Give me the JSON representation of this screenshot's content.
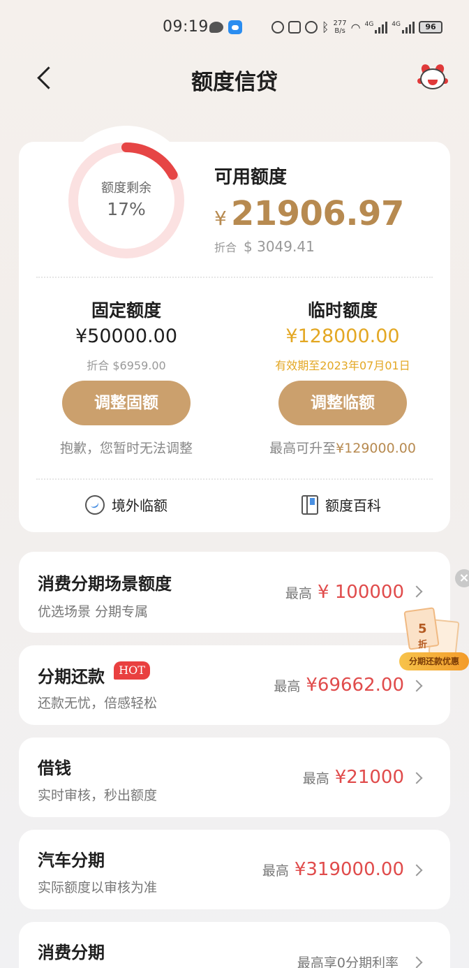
{
  "status": {
    "time": "09:19",
    "net_rate_top": "277",
    "net_rate_bottom": "B/s",
    "net1": "4G",
    "net2": "4G",
    "battery": "96"
  },
  "header": {
    "title": "额度信贷"
  },
  "summary": {
    "ring_label": "额度剩余",
    "ring_percent_text": "17%",
    "ring_fraction": 0.17,
    "available_label": "可用额度",
    "currency": "¥",
    "available_amount": "21906.97",
    "usd_label": "折合",
    "usd_value": "$ 3049.41",
    "fixed": {
      "title": "固定额度",
      "amount": "¥50000.00",
      "sub": "折合 $6959.00",
      "button": "调整固额",
      "note": "抱歉，您暂时无法调整"
    },
    "temp": {
      "title": "临时额度",
      "amount": "¥128000.00",
      "sub": "有效期至2023年07月01日",
      "button": "调整临额",
      "note_prefix": "最高可升至",
      "note_value": "¥129000.00"
    },
    "link_overseas": "境外临额",
    "link_wiki": "额度百科"
  },
  "products": [
    {
      "title": "消费分期场景额度",
      "sub": "优选场景 分期专属",
      "prefix": "最高",
      "amount": "¥ 100000"
    },
    {
      "title": "分期还款",
      "badge": "HOT",
      "sub": "还款无忧，倍感轻松",
      "prefix": "最高",
      "amount": "¥69662.00"
    },
    {
      "title": "借钱",
      "sub": "实时审核，秒出额度",
      "prefix": "最高",
      "amount": "¥21000"
    },
    {
      "title": "汽车分期",
      "sub": "实际额度以审核为准",
      "prefix": "最高",
      "amount": "¥319000.00"
    },
    {
      "title": "消费分期",
      "prefix": "最高享0分期利率"
    }
  ],
  "promo": {
    "number": "5",
    "unit": "折",
    "label": "分期还款优惠",
    "close": "×"
  },
  "colors": {
    "gold": "#b78a50",
    "button": "#cba06d",
    "temp_amount": "#e3a723",
    "red": "#e04b4b",
    "ring_track": "#fbe1e1",
    "ring_fill": "#e64545"
  }
}
